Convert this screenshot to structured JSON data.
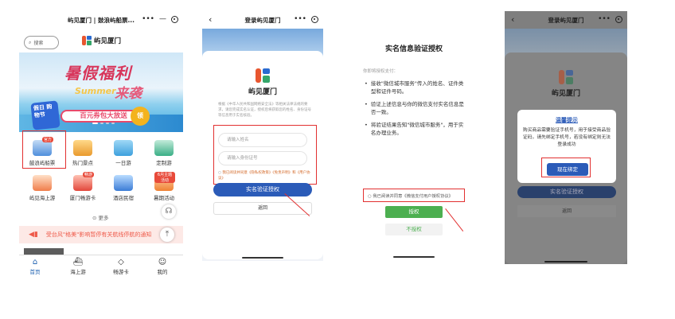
{
  "screen1": {
    "title": "屿见厦门 | 鼓浪屿船票...",
    "search_placeholder": "搜索",
    "logo_text": "屿见厦门",
    "banner": {
      "headline1": "暑假福利",
      "headline2": "来袭",
      "summer_word": "Summer",
      "festival_badge": "假日 购物节",
      "coupon_text": "百元券包大放送",
      "coupon_button": "领"
    },
    "grid_items": [
      {
        "label": "鼓浪屿船票",
        "tag": "官方",
        "icon": "ferry-ticket-icon"
      },
      {
        "label": "热门景点",
        "tag": "",
        "icon": "scenic-icon"
      },
      {
        "label": "一日游",
        "tag": "",
        "icon": "day-tour-icon"
      },
      {
        "label": "定制游",
        "tag": "",
        "icon": "custom-tour-icon"
      },
      {
        "label": "屿见海上游",
        "tag": "",
        "icon": "sea-cruise-icon"
      },
      {
        "label": "厦门畅游卡",
        "tag": "畅游",
        "icon": "travel-card-icon"
      },
      {
        "label": "酒店民宿",
        "tag": "",
        "icon": "hotel-icon"
      },
      {
        "label": "暑期活动",
        "tag": "6月主题活动",
        "icon": "summer-event-icon"
      }
    ],
    "more_label": "更多",
    "notice_text": "受台风\"格美\"影响暂停有关航线停航的通知",
    "tabs": [
      {
        "label": "首页",
        "icon": "home-icon",
        "active": true
      },
      {
        "label": "海上游",
        "icon": "boat-icon",
        "active": false
      },
      {
        "label": "畅游卡",
        "icon": "card-icon",
        "active": false
      },
      {
        "label": "我的",
        "icon": "profile-icon",
        "active": false
      }
    ]
  },
  "screen2": {
    "title": "登录屿见厦门",
    "brand": "屿见厦门",
    "description": "根据《中华人民共和国网络安全法》等相关法律法规的要求，请您完成实名认证，授权后将获取您的姓名、身份证号等信息用于实名核验。",
    "name_placeholder": "请输入姓名",
    "id_placeholder": "请输入身份证号",
    "agreement_text": "我已阅读并同意《隐私权政策》《免责声明》和《用户协议》",
    "verify_button": "实名验证授权",
    "back_button": "返回"
  },
  "screen3": {
    "title": "实名信息验证授权",
    "lead": "你即将授权支付：",
    "bullets": [
      "接收\"微信城市服务\"传入的姓名、证件类型和证件号码。",
      "验证上述信息与你的微信支付实名信息是否一致。",
      "将验证结果告知\"微信城市服务\"，用于实名办理业务。"
    ],
    "agreement_text": "我已阅读并同意《微信支付用户授权协议》",
    "authorize_button": "授权",
    "decline_button": "不授权"
  },
  "screen4": {
    "title": "登录屿见厦门",
    "brand": "屿见厦门",
    "modal_title": "温馨提示",
    "modal_text": "购买商品需要验证手机号，用于接受商品验证码，请先绑定手机号，若没有绑定则无法登录成功",
    "bind_button": "现在绑定",
    "verify_button": "实名验证授权",
    "back_button": "返回"
  },
  "colors": {
    "primary_blue": "#2b5bb8",
    "green": "#4caf50",
    "highlight_red": "#e23030"
  }
}
